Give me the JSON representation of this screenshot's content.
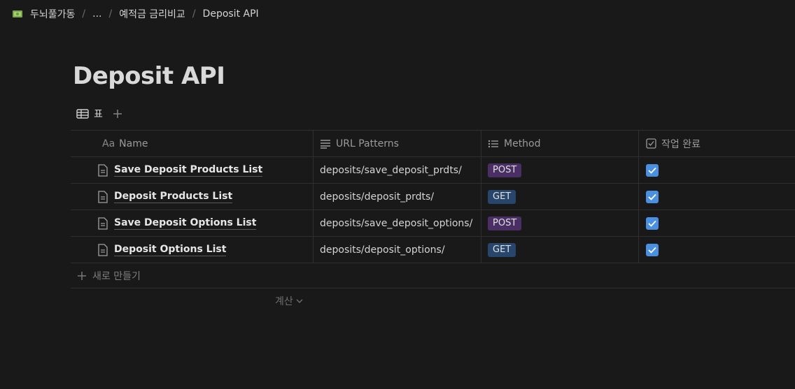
{
  "breadcrumb": {
    "workspace": "두뇌풀가동",
    "ellipsis": "...",
    "parent": "예적금 금리비교",
    "current": "Deposit API",
    "workspace_icon": "money-icon"
  },
  "page": {
    "title": "Deposit API"
  },
  "view": {
    "tab_label": "표",
    "tab_icon": "table-icon",
    "add_icon": "plus-icon"
  },
  "table": {
    "columns": [
      {
        "label": "Name",
        "prefix": "Aa"
      },
      {
        "label": "URL Patterns",
        "icon": "text-lines-icon"
      },
      {
        "label": "Method",
        "icon": "list-icon"
      },
      {
        "label": "작업 완료",
        "icon": "checkbox-icon"
      }
    ],
    "rows": [
      {
        "name": "Save Deposit Products List",
        "url": "deposits/save_deposit_prdts/",
        "method": "POST",
        "done": true
      },
      {
        "name": "Deposit Products List",
        "url": "deposits/deposit_prdts/",
        "method": "GET",
        "done": true
      },
      {
        "name": "Save Deposit Options List",
        "url": "deposits/save_deposit_options/",
        "method": "POST",
        "done": true
      },
      {
        "name": "Deposit Options List",
        "url": "deposits/deposit_options/",
        "method": "GET",
        "done": true
      }
    ],
    "new_row_label": "새로 만들기",
    "calc_label": "계산"
  },
  "colors": {
    "background": "#191919",
    "post_tag": "#492f64",
    "get_tag": "#28456c",
    "checkbox": "#4a8fe0"
  }
}
